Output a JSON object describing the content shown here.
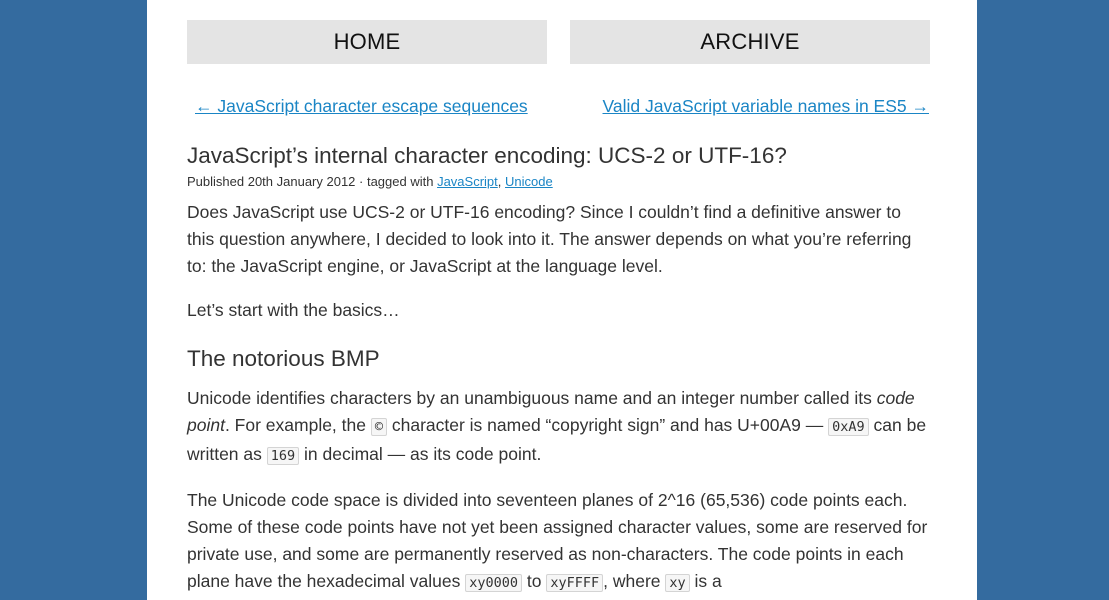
{
  "nav": {
    "home_label": "HOME",
    "archive_label": "ARCHIVE"
  },
  "pager": {
    "prev_label": "← JavaScript character escape sequences",
    "next_label": "Valid JavaScript variable names in ES5 →"
  },
  "post": {
    "title": "JavaScript’s internal character encoding: UCS-2 or UTF-16?",
    "meta_prefix": "Published 20th January 2012 · tagged with ",
    "tags": [
      "JavaScript",
      "Unicode"
    ],
    "tag_separator": ", ",
    "intro": "Does JavaScript use UCS-2 or UTF-16 encoding? Since I couldn’t find a definitive answer to this question anywhere, I decided to look into it. The answer depends on what you’re referring to: the JavaScript engine, or JavaScript at the language level.",
    "basics": "Let’s start with the basics…",
    "section_heading": "The notorious BMP",
    "section_p1": {
      "a": "Unicode identifies characters by an unambiguous name and an integer number called its ",
      "em": "code point",
      "b": ". For example, the ",
      "code1": "©",
      "c": " character is named “copyright sign” and has U+00A9 — ",
      "code2": "0xA9",
      "d": " can be written as ",
      "code3": "169",
      "e": " in decimal — as its code point."
    },
    "section_p2": {
      "a": "The Unicode code space is divided into seventeen planes of 2^16 (65,536) code points each. Some of these code points have not yet been assigned character values, some are reserved for private use, and some are permanently reserved as non-characters. The code points in each plane have the hexadecimal values ",
      "code1": "xy0000",
      "b": " to ",
      "code2": "xyFFFF",
      "c": ", where ",
      "code3": "xy",
      "d": " is a"
    }
  },
  "colors": {
    "background": "#346b9f",
    "link": "#1a85c5",
    "nav_button": "#e4e4e4"
  }
}
